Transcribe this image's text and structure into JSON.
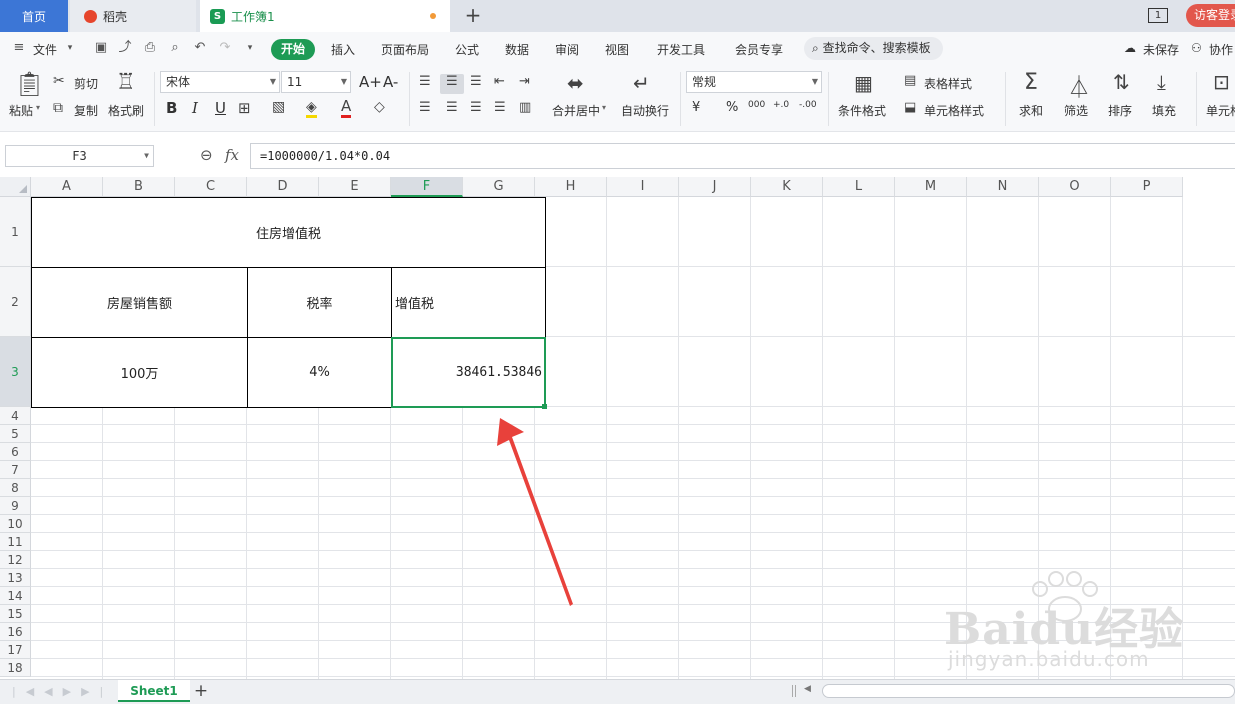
{
  "tabs": {
    "home": "首页",
    "daoke": "稻壳",
    "workbook": "工作簿1",
    "workbook_logo": "S",
    "new_tab": "+"
  },
  "window": {
    "page_indicator": "1",
    "login": "访客登录"
  },
  "menu": {
    "file": "文件",
    "items": [
      "开始",
      "插入",
      "页面布局",
      "公式",
      "数据",
      "审阅",
      "视图",
      "开发工具",
      "会员专享"
    ],
    "search": "查找命令、搜索模板",
    "unsaved": "未保存",
    "collab": "协作"
  },
  "ribbon": {
    "paste": "粘贴",
    "cut": "剪切",
    "copy": "复制",
    "format_painter": "格式刷",
    "font_name": "宋体",
    "font_size": "11",
    "bold": "B",
    "italic": "I",
    "underline": "U",
    "font_grow": "A+",
    "font_shrink": "A-",
    "merge_center": "合并居中",
    "wrap_text": "自动换行",
    "number_format": "常规",
    "currency": "¥",
    "percent": "%",
    "thousands": "000",
    "inc_decimal": "+.0",
    "dec_decimal": "-.00",
    "conditional_format": "条件格式",
    "table_style": "表格样式",
    "cell_style": "单元格样式",
    "sum": "求和",
    "filter": "筛选",
    "sort": "排序",
    "fill": "填充",
    "cell": "单元格"
  },
  "formula_bar": {
    "name_box": "F3",
    "fx": "fx",
    "formula": "=1000000/1.04*0.04"
  },
  "grid": {
    "columns": [
      "A",
      "B",
      "C",
      "D",
      "E",
      "F",
      "G",
      "H",
      "I",
      "J",
      "K",
      "L",
      "M",
      "N",
      "O",
      "P"
    ],
    "selected_column": "F",
    "rows": [
      "1",
      "2",
      "3",
      "4",
      "5",
      "6",
      "7",
      "8",
      "9",
      "10",
      "11",
      "12",
      "13",
      "14",
      "15",
      "16",
      "17",
      "18"
    ],
    "selected_row": "3",
    "cells": {
      "title": "住房增值税",
      "header_sales": "房屋销售额",
      "header_rate": "税率",
      "header_tax": "增值税",
      "value_sales": "100万",
      "value_rate": "4%",
      "value_tax": "38461.53846"
    }
  },
  "sheets": {
    "active": "Sheet1",
    "add": "+"
  },
  "watermark": {
    "brand": "Baidu经验",
    "site": "jingyan.baidu.com"
  },
  "colors": {
    "accent_green": "#1e9b55",
    "home_tab_blue": "#3c76d6",
    "login_red": "#e2574c",
    "annotation_arrow": "#e8413b"
  }
}
